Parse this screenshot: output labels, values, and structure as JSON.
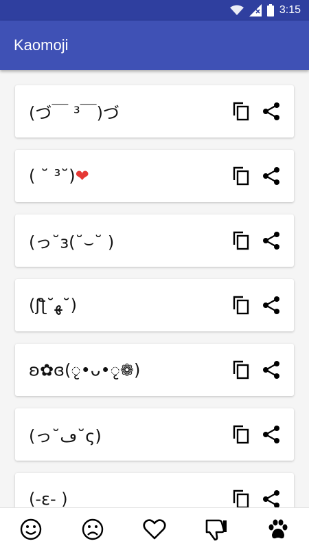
{
  "status_bar": {
    "time": "3:15"
  },
  "app_bar": {
    "title": "Kaomoji"
  },
  "kaomoji": [
    {
      "face": "(づ￣ ³￣)づ"
    },
    {
      "face": "( ˘ ³˘)❤"
    },
    {
      "face": "(っ˘з(˘⌣˘ )"
    },
    {
      "face": "(ʃƪ˘ﻬ˘)"
    },
    {
      "face": "ʚ✿ɞ(ृ•ᴗ•ृ❁)"
    },
    {
      "face": "(っ˘ڡ˘ς)"
    },
    {
      "face": "(-ε- )"
    }
  ],
  "icons": {
    "copy": "copy-icon",
    "share": "share-icon",
    "nav": [
      "happy-face-icon",
      "sad-face-icon",
      "heart-icon",
      "thumbs-down-icon",
      "paw-icon"
    ]
  },
  "colors": {
    "primary": "#3f51b5",
    "primary_dark": "#2f3f9f",
    "heart": "#e53935"
  }
}
